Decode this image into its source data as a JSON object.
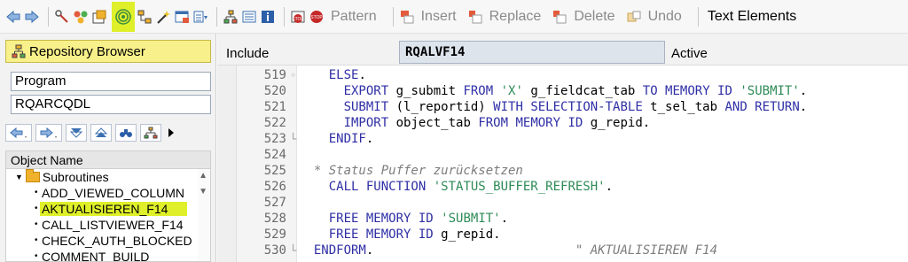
{
  "toolbar": {
    "icons": [
      "back-icon",
      "forward-icon",
      "display-change-icon",
      "activate-icon",
      "other-object-icon",
      "where-used-icon",
      "hierarchy-icon",
      "magic-wand-icon",
      "window-icon",
      "object-list-icon",
      "tree-icon",
      "list-icon",
      "info-icon",
      "stop-icon",
      "breakpoint-icon"
    ],
    "pattern": "Pattern",
    "insert": "Insert",
    "replace": "Replace",
    "delete": "Delete",
    "undo": "Undo",
    "text_elements": "Text Elements"
  },
  "left": {
    "repository_browser": "Repository Browser",
    "object_type": "Program",
    "object_name": "RQARCQDL",
    "tree_header": "Object Name",
    "folder": "Subroutines",
    "items": [
      "ADD_VIEWED_COLUMN",
      "AKTUALISIEREN_F14",
      "CALL_LISTVIEWER_F14",
      "CHECK_AUTH_BLOCKED",
      "COMMENT_BUILD"
    ]
  },
  "header": {
    "include_label": "Include",
    "include_value": "RQALVF14",
    "status": "Active"
  },
  "code": {
    "lines": [
      {
        "no": "519",
        "parts": [
          [
            "t",
            "    "
          ],
          [
            "k",
            "ELSE"
          ],
          [
            "t",
            "."
          ]
        ]
      },
      {
        "no": "520",
        "parts": [
          [
            "t",
            "      "
          ],
          [
            "k",
            "EXPORT"
          ],
          [
            "t",
            " g_submit "
          ],
          [
            "k",
            "FROM"
          ],
          [
            "t",
            " "
          ],
          [
            "s",
            "'X'"
          ],
          [
            "t",
            " g_fieldcat_tab "
          ],
          [
            "k",
            "TO MEMORY ID"
          ],
          [
            "t",
            " "
          ],
          [
            "s",
            "'SUBMIT'"
          ],
          [
            "t",
            "."
          ]
        ]
      },
      {
        "no": "521",
        "parts": [
          [
            "t",
            "      "
          ],
          [
            "k",
            "SUBMIT"
          ],
          [
            "t",
            " (l_reportid) "
          ],
          [
            "k",
            "WITH SELECTION-TABLE"
          ],
          [
            "t",
            " t_sel_tab "
          ],
          [
            "k",
            "AND RETURN"
          ],
          [
            "t",
            "."
          ]
        ]
      },
      {
        "no": "522",
        "parts": [
          [
            "t",
            "      "
          ],
          [
            "k",
            "IMPORT"
          ],
          [
            "t",
            " object_tab "
          ],
          [
            "k",
            "FROM MEMORY ID"
          ],
          [
            "t",
            " g_repid."
          ]
        ]
      },
      {
        "no": "523",
        "parts": [
          [
            "t",
            "    "
          ],
          [
            "k",
            "ENDIF"
          ],
          [
            "t",
            "."
          ]
        ]
      },
      {
        "no": "524",
        "parts": []
      },
      {
        "no": "525",
        "parts": [
          [
            "t",
            "  "
          ],
          [
            "c",
            "* Status Puffer zurücksetzen"
          ]
        ]
      },
      {
        "no": "526",
        "parts": [
          [
            "t",
            "    "
          ],
          [
            "k",
            "CALL FUNCTION"
          ],
          [
            "t",
            " "
          ],
          [
            "s",
            "'STATUS_BUFFER_REFRESH'"
          ],
          [
            "t",
            "."
          ]
        ]
      },
      {
        "no": "527",
        "parts": []
      },
      {
        "no": "528",
        "parts": [
          [
            "t",
            "    "
          ],
          [
            "k",
            "FREE MEMORY ID"
          ],
          [
            "t",
            " "
          ],
          [
            "s",
            "'SUBMIT'"
          ],
          [
            "t",
            "."
          ]
        ]
      },
      {
        "no": "529",
        "parts": [
          [
            "t",
            "    "
          ],
          [
            "k",
            "FREE MEMORY ID"
          ],
          [
            "t",
            " g_repid."
          ]
        ]
      },
      {
        "no": "530",
        "parts": [
          [
            "t",
            "  "
          ],
          [
            "k",
            "ENDFORM"
          ],
          [
            "t",
            ".                           "
          ],
          [
            "c",
            "\" AKTUALISIEREN F14"
          ]
        ]
      }
    ]
  }
}
